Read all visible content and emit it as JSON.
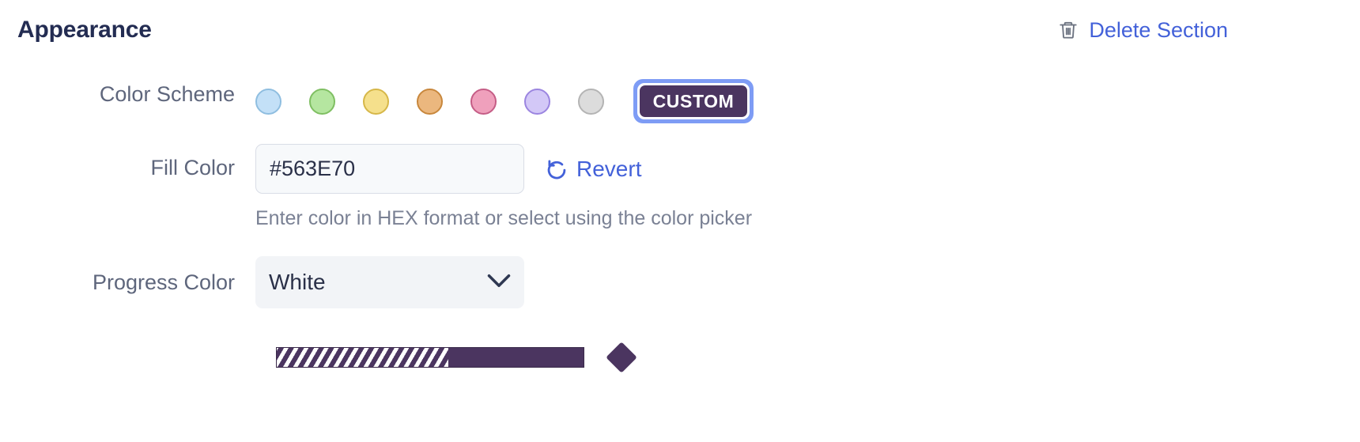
{
  "header": {
    "title": "Appearance",
    "delete_label": "Delete Section",
    "delete_icon": "trash-icon",
    "link_color": "#4361D9",
    "title_color": "#232C52"
  },
  "rows": {
    "color_scheme": {
      "label": "Color Scheme",
      "swatches": [
        {
          "name": "blue",
          "color": "#C3E0F7",
          "border": "#8FBEE0"
        },
        {
          "name": "green",
          "color": "#B5E6A0",
          "border": "#7FBF62"
        },
        {
          "name": "yellow",
          "color": "#F5E08C",
          "border": "#D6B748"
        },
        {
          "name": "orange",
          "color": "#EBB77E",
          "border": "#C8873C"
        },
        {
          "name": "pink",
          "color": "#EFA0BC",
          "border": "#C55D86"
        },
        {
          "name": "purple",
          "color": "#D3C8F7",
          "border": "#9B85E0"
        },
        {
          "name": "grey",
          "color": "#DCDCDC",
          "border": "#B4B4B4"
        }
      ],
      "custom_label": "CUSTOM",
      "custom_bg": "#4B3560",
      "custom_focus_ring": "#7E9CF5",
      "custom_selected": true
    },
    "fill_color": {
      "label": "Fill Color",
      "value": "#563E70",
      "placeholder": "#563E70",
      "revert_label": "Revert",
      "revert_icon": "undo-icon",
      "helper": "Enter color in HEX format or select using the color picker"
    },
    "progress_color": {
      "label": "Progress Color",
      "value": "White",
      "chevron_icon": "chevron-down-icon",
      "options": [
        "White"
      ]
    },
    "preview": {
      "bar_color": "#4B3560",
      "stripe_color": "#FFFFFF",
      "fill_percent": 56,
      "marker_icon": "diamond-marker"
    }
  }
}
